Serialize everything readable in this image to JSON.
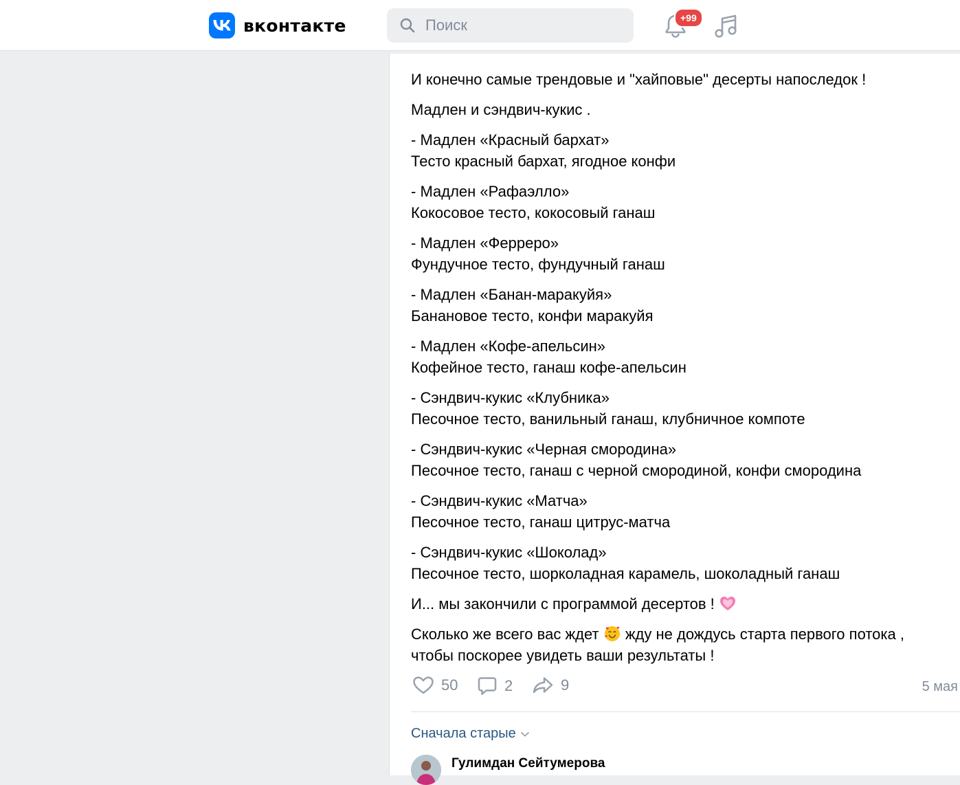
{
  "header": {
    "logo_text": "вконтакте",
    "search_placeholder": "Поиск",
    "notifications_badge": "+99"
  },
  "post": {
    "paragraphs": [
      [
        "И конечно самые трендовые и \"хайповые\" десерты напоследок !"
      ],
      [
        "Мадлен и сэндвич-кукис ."
      ],
      [
        "- Мадлен «Красный бархат»",
        "Тесто красный бархат, ягодное конфи"
      ],
      [
        "- Мадлен «Рафаэлло»",
        "Кокосовое тесто, кокосовый ганаш"
      ],
      [
        "- Мадлен «Ферреро»",
        "Фундучное тесто, фундучный ганаш"
      ],
      [
        "- Мадлен «Банан-маракуйя»",
        "Банановое тесто, конфи маракуйя"
      ],
      [
        "- Мадлен «Кофе-апельсин»",
        "Кофейное тесто, ганаш кофе-апельсин"
      ],
      [
        "- Сэндвич-кукис «Клубника»",
        "Песочное тесто, ванильный ганаш, клубничное компоте"
      ],
      [
        "- Сэндвич-кукис «Черная смородина»",
        "Песочное тесто, ганаш с черной смородиной, конфи смородина"
      ],
      [
        "- Сэндвич-кукис «Матча»",
        "Песочное тесто, ганаш цитрус-матча"
      ],
      [
        "- Сэндвич-кукис «Шоколад»",
        "Песочное тесто, шорколадная карамель, шоколадный ганаш"
      ]
    ],
    "ending_text": "И... мы закончили с программой десертов !",
    "final_part1": "Сколько же всего вас ждет",
    "final_part2": "жду не дождусь старта первого потока ,",
    "final_line2": "чтобы поскорее увидеть ваши результаты !",
    "likes": "50",
    "comments": "2",
    "shares": "9",
    "date": "5 мая"
  },
  "comments_section": {
    "sort_label": "Сначала старые",
    "first_author": "Гулимдан Сейтумерова"
  },
  "icons": {
    "logo": "vk-logo-icon",
    "search": "search-icon",
    "notifications": "bell-icon",
    "music": "music-icon",
    "like": "heart-icon",
    "comment": "comment-icon",
    "share": "share-icon",
    "sort": "chevron-down-icon",
    "emoji_heart": "pink-heart-emoji",
    "emoji_face": "smiling-face-with-hearts-emoji"
  },
  "colors": {
    "accent": "#0077ff",
    "link": "#2a5885",
    "secondary_text": "#818c99",
    "badge": "#e64646",
    "background": "#edeef0"
  }
}
